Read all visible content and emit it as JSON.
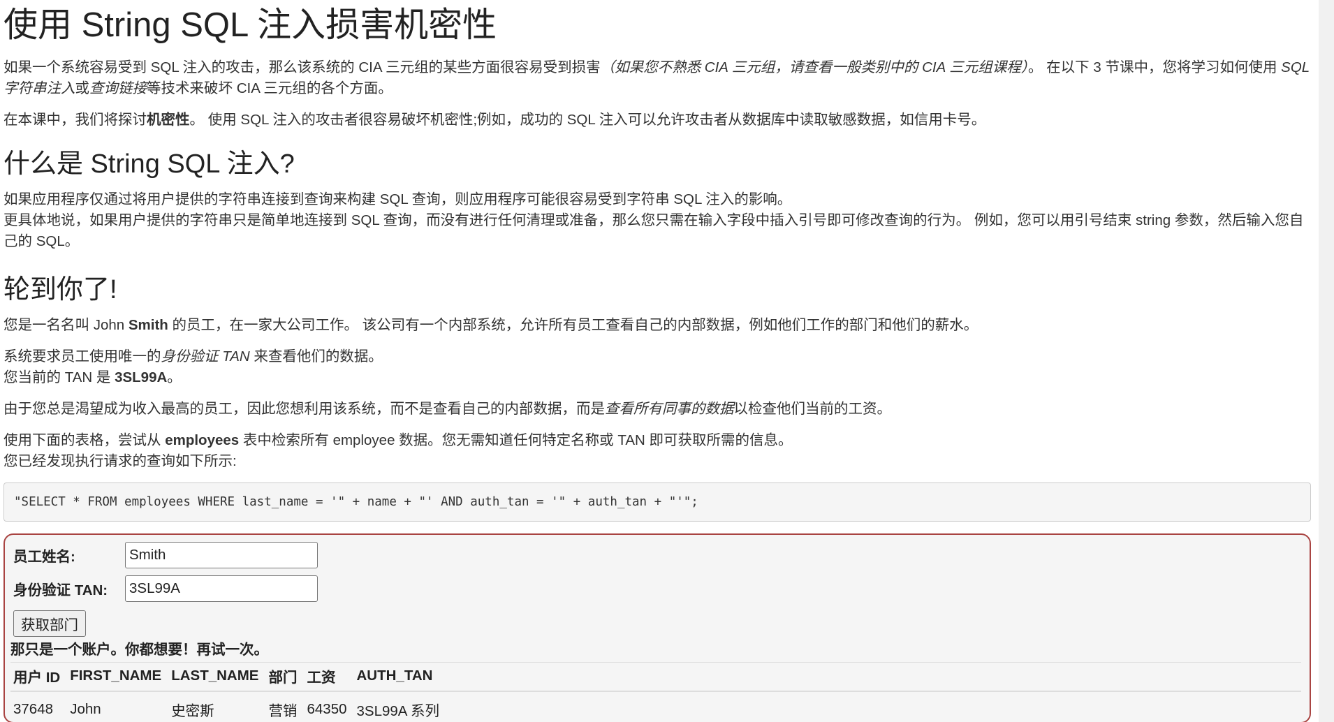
{
  "title": "使用 String SQL 注入损害机密性",
  "intro": {
    "p1_a": "如果一个系统容易受到 SQL 注入的攻击，那么该系统的 CIA 三元组的某些方面很容易受到损害",
    "p1_em": "（如果您不熟悉 CIA 三元组，请查看一般类别中的 CIA 三元组课程）",
    "p1_b": "。 在以下 3 节课中，您将学习如何使用 ",
    "p1_em2": "SQL 字符串注入",
    "p1_c": "或",
    "p1_em3": "查询链接",
    "p1_d": "等技术来破坏 CIA 三元组的各个方面。",
    "p2_a": "在本课中，我们将探讨",
    "p2_b": "机密性",
    "p2_c": "。 使用 SQL 注入的攻击者很容易破坏机密性;例如，成功的 SQL 注入可以允许攻击者从数据库中读取敏感数据，如信用卡号。"
  },
  "section1": {
    "heading": "什么是 String SQL 注入?",
    "line1": "如果应用程序仅通过将用户提供的字符串连接到查询来构建 SQL 查询，则应用程序可能很容易受到字符串 SQL 注入的影响。",
    "line2": "更具体地说，如果用户提供的字符串只是简单地连接到 SQL 查询，而没有进行任何清理或准备，那么您只需在输入字段中插入引号即可修改查询的行为。 例如，您可以用引号结束 string 参数，然后输入您自己的 SQL。"
  },
  "section2": {
    "heading": "轮到你了!",
    "p4_a": "您是一名名叫 John ",
    "p4_b": "Smith",
    "p4_c": " 的员工，在一家大公司工作。 该公司有一个内部系统，允许所有员工查看自己的内部数据，例如他们工作的部门和他们的薪水。",
    "p5_a": "系统要求员工使用唯一的",
    "p5_em": "身份验证 TAN",
    "p5_b": " 来查看他们的数据。",
    "p5_c": "您当前的 TAN 是 ",
    "p5_tan": "3SL99A",
    "p5_d": "。",
    "p6_a": "由于您总是渴望成为收入最高的员工，因此您想利用该系统，而不是查看自己的内部数据，而是",
    "p6_em": "查看所有同事的数据",
    "p6_b": "以检查他们当前的工资。",
    "p7_a": "使用下面的表格，尝试从 ",
    "p7_b": "employees",
    "p7_c": " 表中检索所有 employee 数据。您无需知道任何特定名称或 TAN 即可获取所需的信息。",
    "p7_d": "您已经发现执行请求的查询如下所示:"
  },
  "query": "\"SELECT * FROM employees WHERE last_name = '\" + name + \"' AND auth_tan = '\" + auth_tan + \"'\";",
  "form": {
    "name_label": "员工姓名:",
    "name_value": "Smith",
    "tan_label": "身份验证 TAN:",
    "tan_value": "3SL99A",
    "submit_label": "获取部门"
  },
  "feedback": "那只是一个账户。你都想要！再试一次。",
  "results": {
    "headers": [
      "用户 ID",
      "FIRST_NAME",
      "LAST_NAME",
      "部门",
      "工资",
      "AUTH_TAN"
    ],
    "rows": [
      [
        "37648",
        "John",
        "史密斯",
        "营销",
        "64350",
        "3SL99A 系列"
      ]
    ]
  },
  "colors": {
    "attack_border": "#a94442",
    "panel_bg": "#f5f5f5"
  }
}
